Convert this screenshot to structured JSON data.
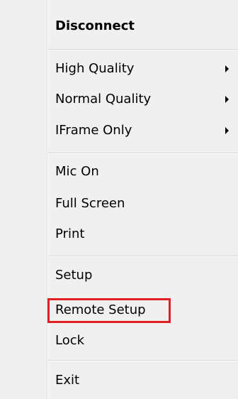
{
  "menu": {
    "items": [
      {
        "label": "Disconnect"
      },
      {
        "label": "High Quality"
      },
      {
        "label": "Normal Quality"
      },
      {
        "label": "IFrame Only"
      },
      {
        "label": "Mic On"
      },
      {
        "label": "Full Screen"
      },
      {
        "label": "Print"
      },
      {
        "label": "Setup"
      },
      {
        "label": "Remote Setup"
      },
      {
        "label": "Lock"
      },
      {
        "label": "Exit"
      }
    ]
  },
  "colors": {
    "menu_background": "#f0f0f0",
    "highlight_border": "#e31e24"
  }
}
